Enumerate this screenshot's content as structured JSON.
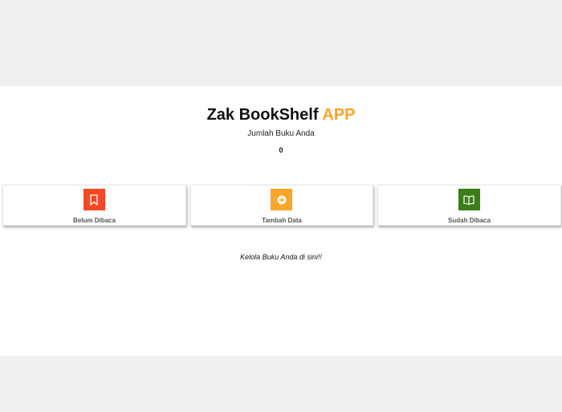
{
  "header": {
    "title_main": "Zak BookShelf",
    "title_accent": "APP",
    "count_label": "Jumlah Buku Anda",
    "count_value": "0"
  },
  "cards": [
    {
      "label": "Belum Dibaca",
      "icon": "bookmark-icon",
      "color": "#f44a24"
    },
    {
      "label": "Tambah Data",
      "icon": "add-circle-icon",
      "color": "#f7a52b"
    },
    {
      "label": "Sudah Dibaca",
      "icon": "open-book-icon",
      "color": "#3c7d17"
    }
  ],
  "footer": {
    "tagline": "Kelola Buku Anda di sini!!"
  },
  "colors": {
    "background": "#f0f0f0",
    "panel": "#ffffff",
    "accent": "#f7a52b"
  }
}
